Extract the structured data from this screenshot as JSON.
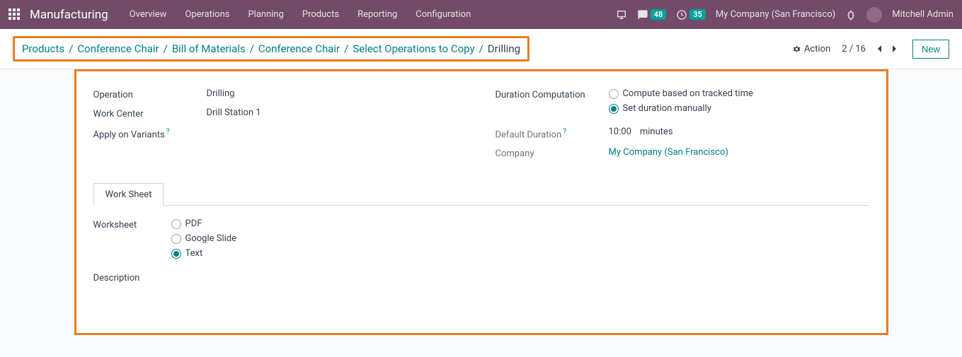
{
  "topbar": {
    "app_title": "Manufacturing",
    "menu": [
      "Overview",
      "Operations",
      "Planning",
      "Products",
      "Reporting",
      "Configuration"
    ],
    "chat_count": "48",
    "activity_count": "35",
    "company": "My Company (San Francisco)",
    "user": "Mitchell Admin"
  },
  "breadcrumb": {
    "items": [
      "Products",
      "Conference Chair",
      "Bill of Materials",
      "Conference Chair",
      "Select Operations to Copy"
    ],
    "current": "Drilling"
  },
  "controls": {
    "action_label": "Action",
    "pager": "2 / 16",
    "new_label": "New"
  },
  "form": {
    "left": {
      "operation_label": "Operation",
      "operation_value": "Drilling",
      "workcenter_label": "Work Center",
      "workcenter_value": "Drill Station 1",
      "variants_label": "Apply on Variants"
    },
    "right": {
      "duration_comp_label": "Duration Computation",
      "duration_opts": {
        "tracked": "Compute based on tracked time",
        "manual": "Set duration manually"
      },
      "default_duration_label": "Default Duration",
      "default_duration_value": "10:00",
      "default_duration_unit": "minutes",
      "company_label": "Company",
      "company_value": "My Company (San Francisco)"
    },
    "tabs": {
      "worksheet": "Work Sheet"
    },
    "worksheet": {
      "label": "Worksheet",
      "opts": {
        "pdf": "PDF",
        "slide": "Google Slide",
        "text": "Text"
      },
      "description_label": "Description"
    }
  }
}
